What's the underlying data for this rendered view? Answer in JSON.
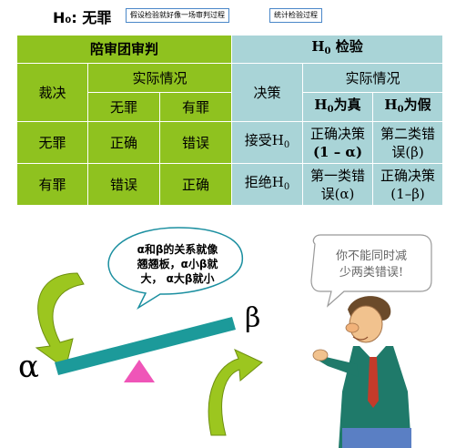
{
  "header": {
    "title": "H₀: 无罪",
    "tag_jury": "假设检验就好像一场审判过程",
    "tag_process": "统计检验过程"
  },
  "jury_table": {
    "title": "陪审团审判",
    "col_verdict": "裁决",
    "col_actual": "实际情况",
    "innocent": "无罪",
    "guilty": "有罪",
    "rows": [
      {
        "verdict": "无罪",
        "innocent": "正确",
        "guilty": "错误"
      },
      {
        "verdict": "有罪",
        "innocent": "错误",
        "guilty": "正确"
      }
    ]
  },
  "h0_table": {
    "title_prefix": "H",
    "title_sub": "0",
    "title_suffix": " 检验",
    "col_decision": "决策",
    "col_actual": "实际情况",
    "true_prefix": "H",
    "true_sub": "0",
    "true_suffix": "为真",
    "false_prefix": "H",
    "false_sub": "0",
    "false_suffix": "为假",
    "rows": [
      {
        "decision_prefix": "接受H",
        "decision_sub": "0",
        "true_line1": "正确决策",
        "true_line2": "(1 – α)",
        "false_line1": "第二类错",
        "false_line2": "误(β)"
      },
      {
        "decision_prefix": "拒绝H",
        "decision_sub": "0",
        "true_line1": "第一类错",
        "true_line2": "误(α)",
        "false_line1": "正确决策",
        "false_line2": "(1–β)"
      }
    ]
  },
  "illustration": {
    "left_bubble": [
      "α和β的关系就像",
      "翘翘板，α小β就",
      "大，  α大β就小"
    ],
    "right_bubble": [
      "你不能同时减",
      "少两类错误!"
    ],
    "alpha": "α",
    "beta": "β",
    "colors": {
      "seesaw": "#1c9a9a",
      "fulcrum": "#ef55b8",
      "arrow": "#9cc61f",
      "arrow_dark": "#6e8f10"
    }
  }
}
